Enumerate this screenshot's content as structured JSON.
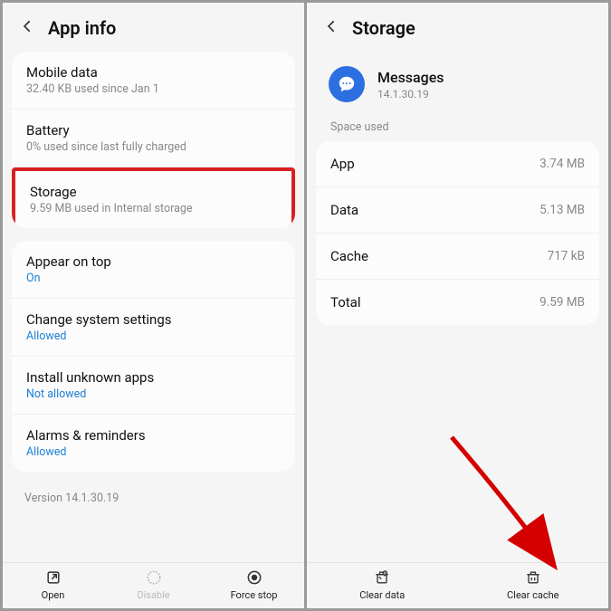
{
  "left": {
    "title": "App info",
    "items": [
      {
        "title": "Mobile data",
        "sub": "32.40 KB used since Jan 1",
        "blue": false
      },
      {
        "title": "Battery",
        "sub": "0% used since last fully charged",
        "blue": false
      },
      {
        "title": "Storage",
        "sub": "9.59 MB used in Internal storage",
        "blue": false,
        "highlight": true
      }
    ],
    "items2": [
      {
        "title": "Appear on top",
        "sub": "On",
        "blue": true
      },
      {
        "title": "Change system settings",
        "sub": "Allowed",
        "blue": true
      },
      {
        "title": "Install unknown apps",
        "sub": "Not allowed",
        "blue": true
      },
      {
        "title": "Alarms & reminders",
        "sub": "Allowed",
        "blue": true
      }
    ],
    "version": "Version 14.1.30.19",
    "bottom": [
      {
        "label": "Open",
        "icon": "open"
      },
      {
        "label": "Disable",
        "icon": "disable",
        "disabled": true
      },
      {
        "label": "Force stop",
        "icon": "stop"
      }
    ]
  },
  "right": {
    "title": "Storage",
    "app_name": "Messages",
    "app_version": "14.1.30.19",
    "section_label": "Space used",
    "rows": [
      {
        "label": "App",
        "value": "3.74 MB"
      },
      {
        "label": "Data",
        "value": "5.13 MB"
      },
      {
        "label": "Cache",
        "value": "717 kB"
      },
      {
        "label": "Total",
        "value": "9.59 MB"
      }
    ],
    "bottom": [
      {
        "label": "Clear data",
        "icon": "trash"
      },
      {
        "label": "Clear cache",
        "icon": "trash"
      }
    ]
  }
}
